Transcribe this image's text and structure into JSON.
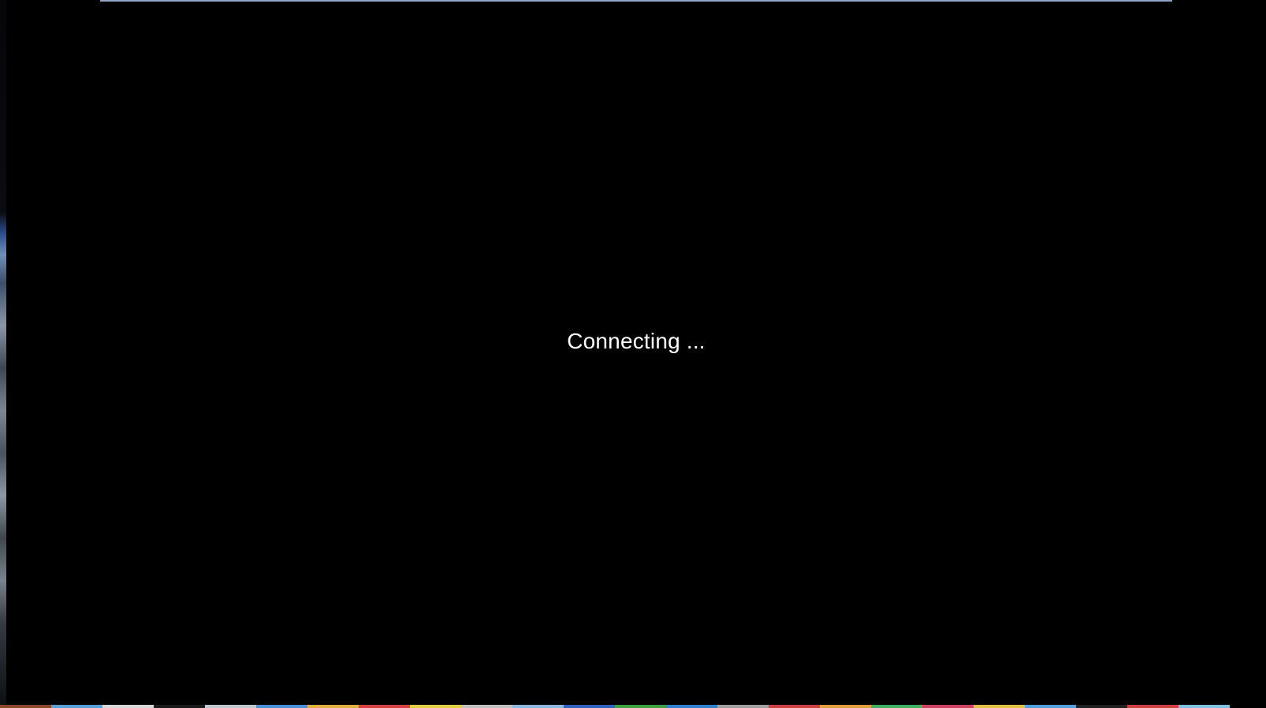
{
  "status": {
    "message": "Connecting ..."
  },
  "colors": {
    "background": "#000000",
    "text": "#ffffff",
    "window_accent": "#8fa3c4"
  },
  "dock": {
    "visible_colors": [
      "#8a4a2a",
      "#5aa0d8",
      "#d8d8d8",
      "#1a1a1a",
      "#c0c8d0",
      "#4a8fd8",
      "#e0b040",
      "#d84040",
      "#e0d040",
      "#c0c0c0",
      "#8ab8e0",
      "#3060c0",
      "#40a040",
      "#3080d0",
      "#a0a0a0",
      "#d04040",
      "#e0a040",
      "#40b060",
      "#d04060",
      "#e0c040",
      "#50a0e0",
      "#202020",
      "#d04040",
      "#80c0e0"
    ]
  }
}
